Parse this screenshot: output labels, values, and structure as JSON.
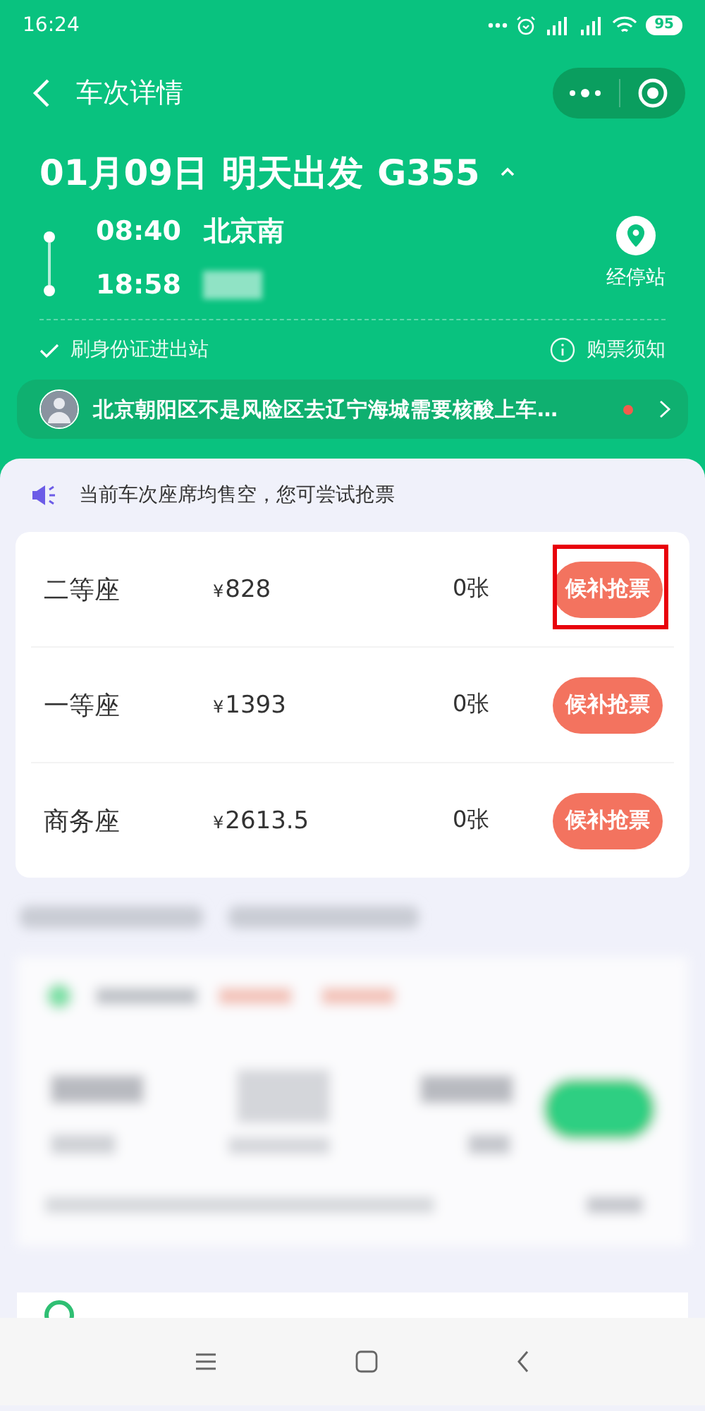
{
  "status_bar": {
    "time": "16:24",
    "battery": "95"
  },
  "header": {
    "title": "车次详情"
  },
  "trip": {
    "date": "01月09日",
    "relative_day": "明天出发",
    "train_number": "G355",
    "departure": {
      "time": "08:40",
      "station": "北京南"
    },
    "arrival": {
      "time": "18:58"
    },
    "stops_label": "经停站"
  },
  "id_entry": "刷身份证进出站",
  "purchase_notice": "购票须知",
  "notice": {
    "text": "北京朝阳区不是风险区去辽宁海城需要核酸上车…",
    "unread": true
  },
  "sold_out_notice": "当前车次座席均售空，您可尝试抢票",
  "seats": [
    {
      "class": "二等座",
      "currency": "¥",
      "price": "828",
      "count": "0张",
      "action": "候补抢票",
      "highlighted": true
    },
    {
      "class": "一等座",
      "currency": "¥",
      "price": "1393",
      "count": "0张",
      "action": "候补抢票",
      "highlighted": false
    },
    {
      "class": "商务座",
      "currency": "¥",
      "price": "2613.5",
      "count": "0张",
      "action": "候补抢票",
      "highlighted": false
    }
  ]
}
